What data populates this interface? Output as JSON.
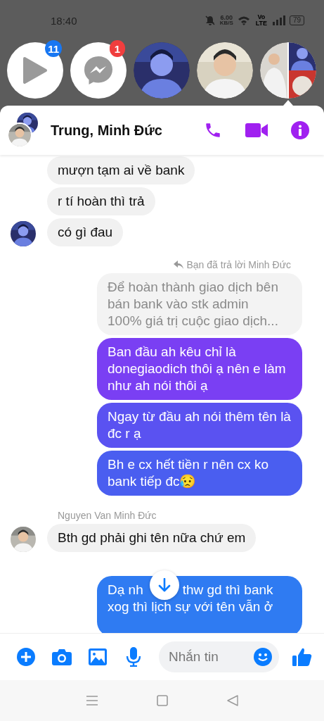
{
  "status_bar": {
    "time": "18:40",
    "speed": "6.00",
    "speed_unit": "KB/S",
    "network": "Vo LTE",
    "battery": "79"
  },
  "chat_heads": [
    {
      "kind": "app",
      "badge": "11",
      "color": "#1877f2"
    },
    {
      "kind": "messenger",
      "badge": "1",
      "color": "#f03e3e"
    },
    {
      "kind": "avatar"
    },
    {
      "kind": "avatar"
    },
    {
      "kind": "group"
    }
  ],
  "header": {
    "title": "Trung, Minh Đức"
  },
  "messages": [
    {
      "kind": "received",
      "text": "mượn tạm ai về bank",
      "avatar": false
    },
    {
      "kind": "received",
      "text": "r tí hoàn thì trả",
      "avatar": false
    },
    {
      "kind": "received",
      "text": "có gì đau",
      "avatar": true
    },
    {
      "kind": "reply_note",
      "text": "Bạn đã trả lời Minh Đức"
    },
    {
      "kind": "quoted",
      "text": "Để hoàn thành giao dịch bên bán bank vào stk admin 100% giá trị cuộc giao dịch..."
    },
    {
      "kind": "sent",
      "text": "Ban đầu ah kêu chỉ là donegiaodich thôi ạ nên e làm như ah nói thôi ạ",
      "color": "#7a3ff3"
    },
    {
      "kind": "sent",
      "text": "Ngay từ đầu ah nói thêm tên là đc r ạ",
      "color": "#5a52f1"
    },
    {
      "kind": "sent",
      "text": "Bh e cx hết tiền r nên cx ko bank tiếp đc😥",
      "color": "#4a5ef0"
    },
    {
      "kind": "sender_name",
      "text": "Nguyen Van Minh Đức"
    },
    {
      "kind": "received",
      "text": "Bth gd phải ghi tên nữa chứ em",
      "avatar": true
    },
    {
      "kind": "sent_partial",
      "parts": [
        "Dạ nh",
        "thw gd thì bank",
        "xog thì lịch sự với tên vẫn ở"
      ],
      "color": "#2f7bf2"
    }
  ],
  "composer": {
    "placeholder": "Nhắn tin"
  }
}
